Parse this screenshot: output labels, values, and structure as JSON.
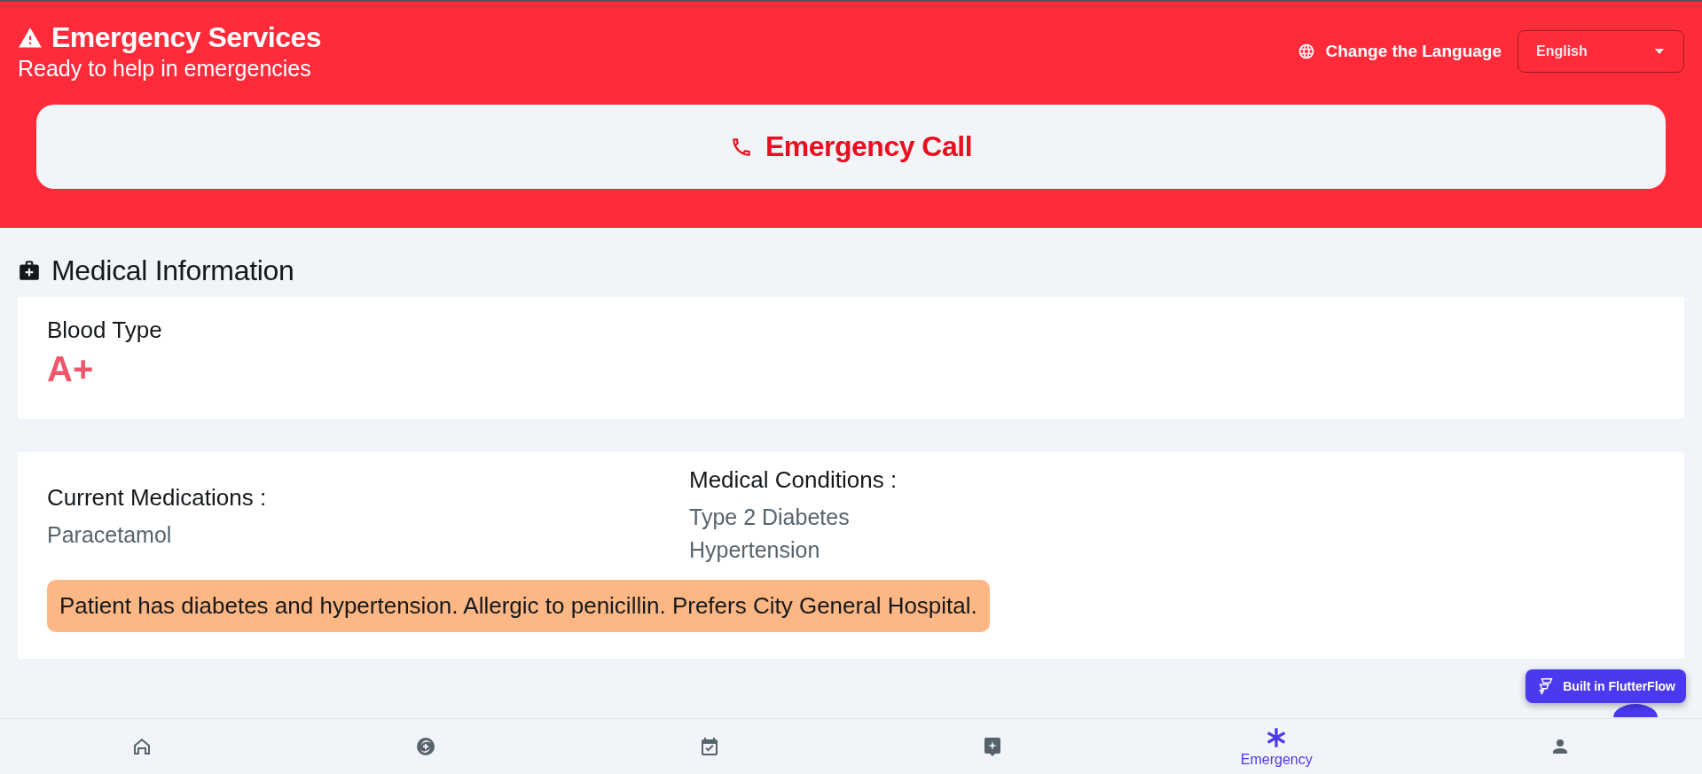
{
  "header": {
    "title": "Emergency Services",
    "subtitle": "Ready to help in emergencies",
    "language_label": "Change the Language",
    "language_select": {
      "value": "English"
    },
    "call_button": "Emergency Call"
  },
  "medical": {
    "title": "Medical Information",
    "blood_type": {
      "label": "Blood Type",
      "value": "A+"
    },
    "medications": {
      "label": "Current Medications :",
      "items": [
        "Paracetamol"
      ]
    },
    "conditions": {
      "label": "Medical Conditions :",
      "items": [
        "Type 2 Diabetes",
        "Hypertension"
      ]
    },
    "note": "Patient has diabetes and hypertension. Allergic to penicillin. Prefers City General Hospital."
  },
  "badge": "Built in FlutterFlow",
  "nav": [
    {
      "selected": false
    },
    {
      "selected": false
    },
    {
      "selected": false
    },
    {
      "selected": false
    },
    {
      "label": "Emergency",
      "selected": true
    },
    {
      "selected": false
    }
  ]
}
